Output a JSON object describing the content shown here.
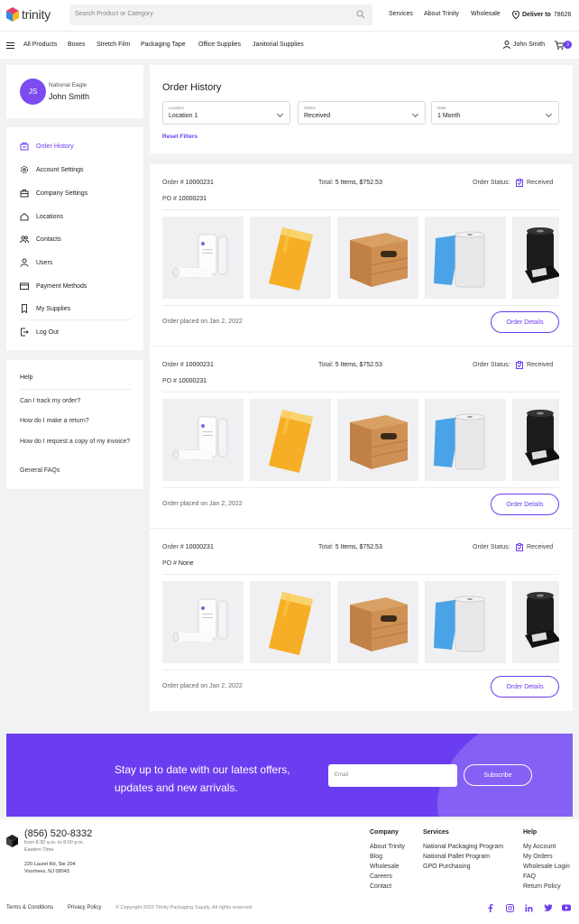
{
  "header": {
    "logo_text": "trinity",
    "search_placeholder": "Search Product or Category",
    "links": [
      "Services",
      "About Trinity",
      "Wholesale"
    ],
    "deliver_label": "Deliver to",
    "deliver_zip": "78626"
  },
  "nav": {
    "items": [
      "All Products",
      "Boxes",
      "Stretch Film",
      "Packaging Tape",
      "Office Supplies",
      "Janitorial Supplies"
    ],
    "user_name": "John Smith",
    "cart_count": "3"
  },
  "profile": {
    "initials": "JS",
    "company": "National Eagle",
    "name": "John Smith"
  },
  "sidebar": {
    "items": [
      {
        "label": "Order History",
        "icon": "cart-icon"
      },
      {
        "label": "Account Settings",
        "icon": "gear-icon"
      },
      {
        "label": "Company Settings",
        "icon": "briefcase-icon"
      },
      {
        "label": "Locations",
        "icon": "home-icon"
      },
      {
        "label": "Contacts",
        "icon": "contacts-icon"
      },
      {
        "label": "Users",
        "icon": "user-icon"
      },
      {
        "label": "Payment Methods",
        "icon": "credit-card-icon"
      },
      {
        "label": "My Supplies",
        "icon": "bookmark-icon"
      },
      {
        "label": "Log Out",
        "icon": "logout-icon"
      }
    ]
  },
  "help": {
    "title": "Help",
    "questions": [
      "Can I track my order?",
      "How do I make a return?",
      "How do I request a copy of my invoice?",
      "General FAQs"
    ]
  },
  "filters": {
    "title": "Order History",
    "location_label": "Location",
    "location_value": "Location 1",
    "status_label": "Status",
    "status_value": "Received",
    "date_label": "Date",
    "date_value": "1 Month",
    "reset_label": "Reset Filters"
  },
  "orders": [
    {
      "order_prefix": "Order #",
      "order_no": "10000231",
      "total_prefix": "Total:",
      "total": "5 Items, $752.53",
      "status_prefix": "Order Status:",
      "status": "Received",
      "po_prefix": "PO #",
      "po": "10000231",
      "placed": "Order placed on Jan 2, 2022",
      "button": "Order Details"
    },
    {
      "order_prefix": "Order #",
      "order_no": "10000231",
      "total_prefix": "Total:",
      "total": "5 Items, $752.53",
      "status_prefix": "Order Status:",
      "status": "Received",
      "po_prefix": "PO #",
      "po": "10000231",
      "placed": "Order placed on Jan 2, 2022",
      "button": "Order Details"
    },
    {
      "order_prefix": "Order #",
      "order_no": "10000231",
      "total_prefix": "Total:",
      "total": "5 Items, $752.53",
      "status_prefix": "Order Status:",
      "status": "Received",
      "po_prefix": "PO #",
      "po": "None",
      "placed": "Order placed on Jan 2, 2022",
      "button": "Order Details"
    }
  ],
  "newsletter": {
    "heading": "Stay up to date with our latest offers, updates and new arrivals.",
    "email_placeholder": "Email",
    "button": "Subscribe"
  },
  "footer": {
    "phone": "(856) 520-8332",
    "hours1": "from 8:30 a.m. to 8:00 p.m.",
    "hours2": "Eastern Time",
    "address1": "220 Laurel Rd, Ste 204",
    "address2": "Voorhees, NJ 08043",
    "company_title": "Company",
    "company_links": [
      "About Trinity",
      "Blog",
      "Wholesale",
      "Careers",
      "Contact"
    ],
    "services_title": "Services",
    "services_links": [
      "National Packaging Program",
      "National Pallet Program",
      "GPO Purchasing"
    ],
    "help_title": "Help",
    "help_links": [
      "My Account",
      "My Orders",
      "Wholesale Login",
      "FAQ",
      "Return Policy"
    ],
    "terms": "Terms & Conditions",
    "privacy": "Privacy Policy",
    "copyright": "© Copyright 2022 Trinity Packaging Supply, All rights reserved",
    "socials": [
      "facebook-icon",
      "instagram-icon",
      "linkedin-icon",
      "twitter-icon",
      "youtube-icon"
    ]
  },
  "colors": {
    "accent": "#6c3df0",
    "background": "#f1f2f4",
    "newsletter": "#6b3df0"
  }
}
